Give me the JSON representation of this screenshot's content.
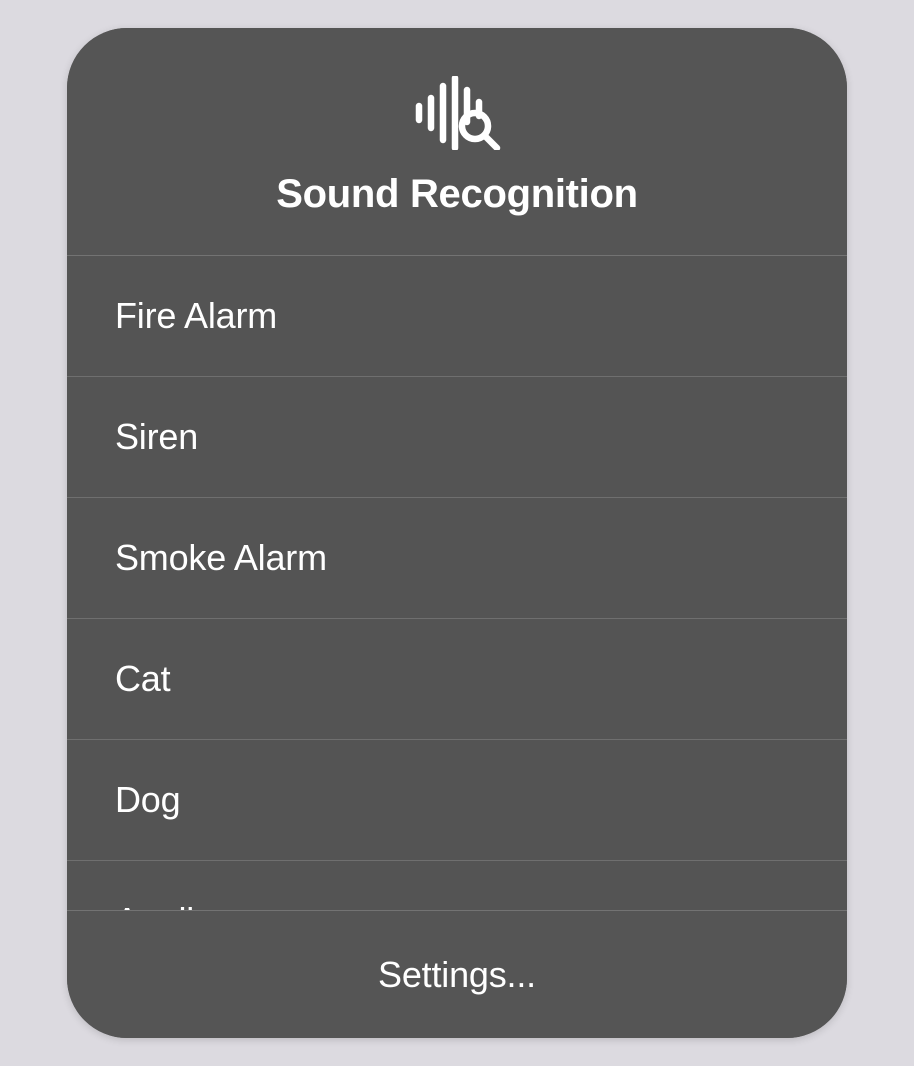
{
  "header": {
    "title": "Sound Recognition",
    "icon": "sound-recognition-icon"
  },
  "sounds": [
    {
      "label": "Fire Alarm"
    },
    {
      "label": "Siren"
    },
    {
      "label": "Smoke Alarm"
    },
    {
      "label": "Cat"
    },
    {
      "label": "Dog"
    },
    {
      "label": "Appliances"
    }
  ],
  "footer": {
    "settings_label": "Settings..."
  }
}
